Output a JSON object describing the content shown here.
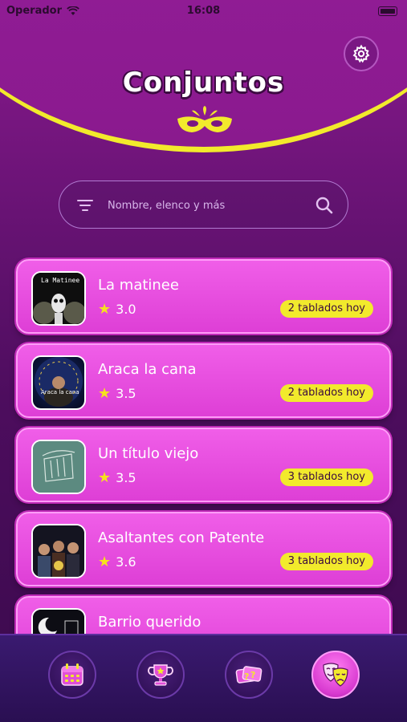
{
  "status_bar": {
    "carrier": "Operador",
    "time": "16:08"
  },
  "header": {
    "title": "Conjuntos",
    "settings_icon": "gear-icon",
    "logo_icon": "carnival-mask-icon"
  },
  "search": {
    "placeholder": "Nombre, elenco y más",
    "filter_icon": "filter-icon",
    "search_icon": "search-icon"
  },
  "colors": {
    "accent_yellow": "#f2ea2c",
    "card_pink": "#e64ce0",
    "background_purple": "#6d1478"
  },
  "groups": [
    {
      "name": "La matinee",
      "rating": "3.0",
      "badge": "2 tablados hoy"
    },
    {
      "name": "Araca la cana",
      "rating": "3.5",
      "badge": "2 tablados hoy"
    },
    {
      "name": "Un título viejo",
      "rating": "3.5",
      "badge": "3 tablados hoy"
    },
    {
      "name": "Asaltantes con Patente",
      "rating": "3.6",
      "badge": "3 tablados hoy"
    },
    {
      "name": "Barrio querido",
      "rating": "",
      "badge": ""
    }
  ],
  "thumbnail_text": {
    "la_matinee": "La Matinee",
    "araca": "Araca la cana"
  },
  "tabs": [
    {
      "icon": "calendar-icon",
      "active": false
    },
    {
      "icon": "trophy-icon",
      "active": false
    },
    {
      "icon": "tickets-icon",
      "active": false
    },
    {
      "icon": "theater-masks-icon",
      "active": true
    }
  ]
}
